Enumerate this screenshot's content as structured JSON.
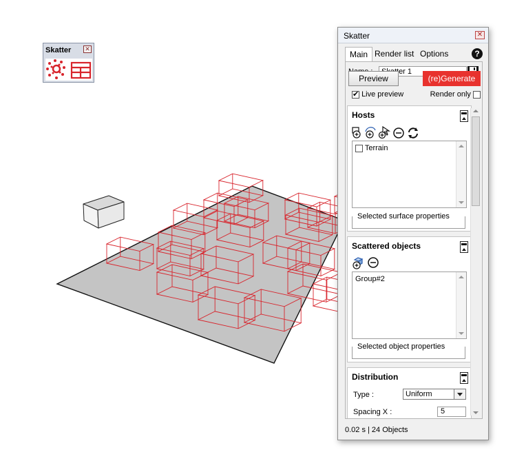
{
  "toolbar": {
    "title": "Skatter",
    "close_glyph": "✕",
    "icons": [
      "scatter-icon",
      "render-list-icon"
    ]
  },
  "panel": {
    "title": "Skatter",
    "close_glyph": "✕",
    "tabs": [
      {
        "label": "Main",
        "active": true
      },
      {
        "label": "Render list",
        "active": false
      },
      {
        "label": "Options",
        "active": false
      }
    ],
    "help_glyph": "?",
    "name_label": "Name :",
    "name_value": "Skatter 1",
    "preview_label": "Preview",
    "generate_label": "(re)Generate",
    "live_preview_label": "Live preview",
    "live_preview_checked": true,
    "render_only_label": "Render only",
    "render_only_checked": false
  },
  "hosts": {
    "title": "Hosts",
    "icons": [
      "add-host-icon",
      "add-host-by-pick-icon",
      "add-host-cursor-icon",
      "remove-host-icon",
      "refresh-icon"
    ],
    "items": [
      {
        "label": "Terrain",
        "checked": false
      }
    ],
    "props_label": "Selected surface properties"
  },
  "scattered": {
    "title": "Scattered objects",
    "icons": [
      "add-object-icon",
      "remove-object-icon"
    ],
    "items": [
      {
        "label": "Group#2"
      }
    ],
    "props_label": "Selected object properties"
  },
  "distribution": {
    "title": "Distribution",
    "type_label": "Type :",
    "type_value": "Uniform",
    "spacing_label": "Spacing X :",
    "spacing_value": "5"
  },
  "status": "0.02 s | 24 Objects",
  "colors": {
    "accent_red": "#e8322e",
    "wire_red": "#d8242c",
    "ground_gray": "#c0c0c0"
  }
}
